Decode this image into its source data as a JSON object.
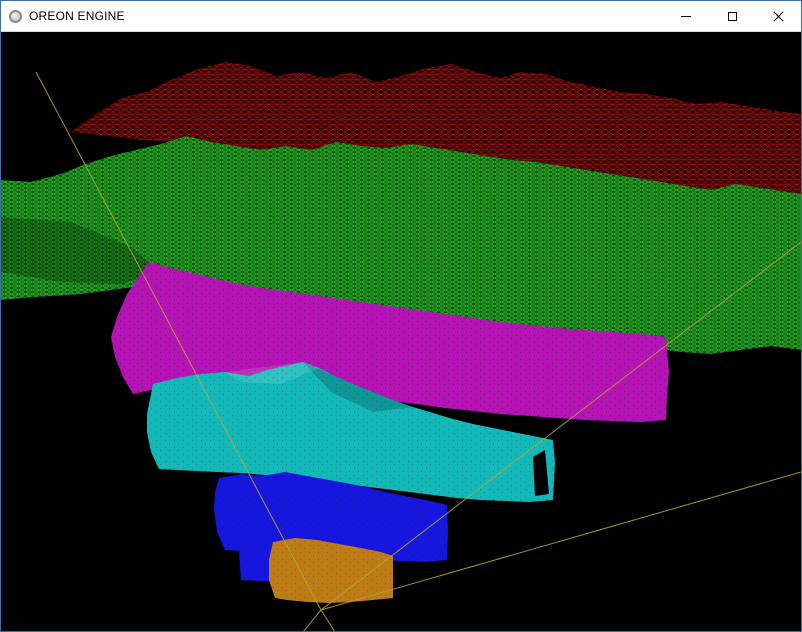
{
  "window": {
    "title": "OREON ENGINE",
    "icons": {
      "app": "circle-outline-icon",
      "minimize": "window-minimize-icon",
      "maximize": "window-maximize-icon",
      "close": "window-close-icon"
    }
  },
  "viewport": {
    "description": "3D terrain LOD visualization, wireframe far bands and solid near bands over black background with yellow view-frustum lines",
    "background": "#000000",
    "frustum_color": "#b5a42e",
    "lod_bands": [
      {
        "id": "lod-0-far",
        "style": "wireframe",
        "color": "#a61212",
        "base": "#2e0303"
      },
      {
        "id": "lod-1",
        "style": "wireframe",
        "color": "#2ec22e",
        "base": "#0b570b"
      },
      {
        "id": "lod-2",
        "style": "solid",
        "color": "#b414b4",
        "base": "#8c0f8c"
      },
      {
        "id": "lod-3",
        "style": "solid",
        "color": "#14b8b8",
        "base": "#0e8f8f"
      },
      {
        "id": "lod-4",
        "style": "solid",
        "color": "#1616dc",
        "base": "#1010a8"
      },
      {
        "id": "lod-5-near",
        "style": "solid",
        "color": "#bd7c17",
        "base": "#96620f"
      }
    ]
  }
}
